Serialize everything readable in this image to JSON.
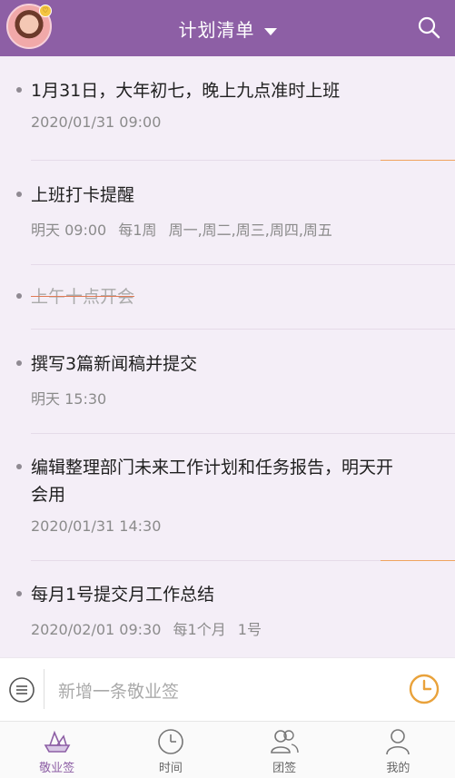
{
  "header": {
    "title": "计划清单",
    "avatar_badge": "♡"
  },
  "items": [
    {
      "title": "1月31日，大年初七，晚上九点准时上班",
      "meta": [
        "2020/01/31 09:00"
      ],
      "done": false
    },
    {
      "title": "上班打卡提醒",
      "meta": [
        "明天 09:00",
        "每1周",
        "周一,周二,周三,周四,周五"
      ],
      "done": false
    },
    {
      "title": "上午十点开会",
      "meta": [],
      "done": true
    },
    {
      "title": "撰写3篇新闻稿并提交",
      "meta": [
        "明天 15:30"
      ],
      "done": false
    },
    {
      "title": "编辑整理部门未来工作计划和任务报告，明天开会用",
      "meta": [
        "2020/01/31 14:30"
      ],
      "done": false
    },
    {
      "title": "每月1号提交月工作总结",
      "meta": [
        "2020/02/01 09:30",
        "每1个月",
        "1号"
      ],
      "done": false
    }
  ],
  "composer": {
    "placeholder": "新增一条敬业签"
  },
  "tabbar": {
    "tabs": [
      {
        "label": "敬业签",
        "icon": "boat-icon",
        "active": true
      },
      {
        "label": "时间",
        "icon": "clock-icon",
        "active": false
      },
      {
        "label": "团签",
        "icon": "team-icon",
        "active": false
      },
      {
        "label": "我的",
        "icon": "person-icon",
        "active": false
      }
    ]
  },
  "colors": {
    "header_bg": "#8d5fa5",
    "accent_orange": "#f0a35e",
    "clock_orange": "#e9a23b"
  }
}
